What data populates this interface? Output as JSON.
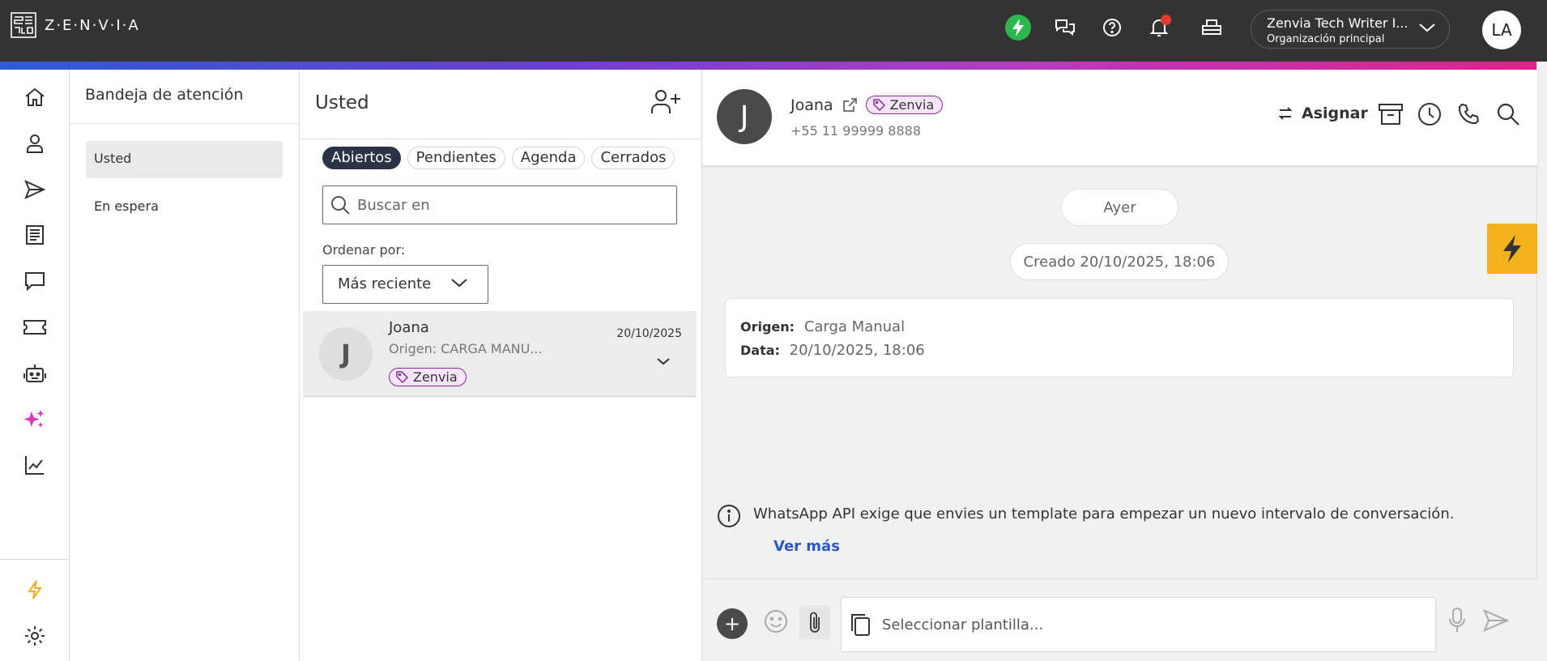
{
  "topbar": {
    "logo_text": "Z·E·N·V·I·A",
    "org_name": "Zenvia Tech Writer I...",
    "org_subtitle": "Organización principal",
    "user_initials": "LA",
    "icons": [
      "bolt-status-icon",
      "chat-bubbles-icon",
      "help-icon",
      "bell-icon",
      "printer-icon",
      "chevron-down-icon"
    ],
    "status_color": "#2db84d",
    "notification_dot_color": "#e53935"
  },
  "leftnav": {
    "items": [
      "home-icon",
      "contacts-icon",
      "send-icon",
      "document-icon",
      "chat-icon",
      "ticket-icon",
      "bot-icon",
      "sparkles-icon",
      "analytics-icon"
    ],
    "bottom_items": [
      "bolt-icon",
      "settings-icon"
    ],
    "sparkles_color": "#d63ab8",
    "bolt_color": "#f2b01e"
  },
  "inbox": {
    "title": "Bandeja de atención",
    "items": [
      {
        "label": "Usted",
        "active": true
      },
      {
        "label": "En espera",
        "active": false
      }
    ]
  },
  "conversations": {
    "title": "Usted",
    "tabs": [
      {
        "label": "Abiertos",
        "active": true
      },
      {
        "label": "Pendientes",
        "active": false
      },
      {
        "label": "Agenda",
        "active": false
      },
      {
        "label": "Cerrados",
        "active": false
      }
    ],
    "search_placeholder": "Buscar en",
    "order_label": "Ordenar por:",
    "order_value": "Más reciente",
    "items": [
      {
        "initial": "J",
        "name": "Joana",
        "origin": "Origen: CARGA MANU...",
        "date": "20/10/2025",
        "tag": "Zenvia"
      }
    ]
  },
  "chat": {
    "contact_initial": "J",
    "contact_name": "Joana",
    "contact_tag": "Zenvia",
    "contact_phone": "+55 11 99999 8888",
    "assign_label": "Asignar",
    "day_label": "Ayer",
    "created_label": "Creado 20/10/2025, 18:06",
    "info": {
      "origin_key": "Origen:",
      "origin_value": "Carga Manual",
      "data_key": "Data:",
      "data_value": "20/10/2025, 18:06"
    },
    "notice": "WhatsApp API exige que envies un template para empezar un nuevo intervalo de conversación.",
    "notice_link": "Ver más",
    "composer_placeholder": "Seleccionar plantilla...",
    "accent_bolt_color": "#f3b21b",
    "link_color": "#2b58c7"
  }
}
